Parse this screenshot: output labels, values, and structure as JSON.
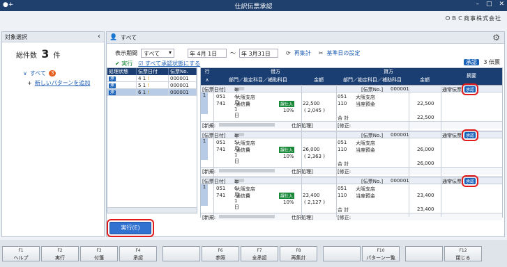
{
  "titlebar": {
    "title": "仕訳伝票承認",
    "logo": "●+"
  },
  "company": "ＯＢＣ商事株式会社",
  "left_panel": {
    "header": "対象選択",
    "total_label": "総件数",
    "total_value": "3",
    "total_unit": "件",
    "tree_all": "すべて",
    "tree_badge": "3",
    "tree_add": "新しいパターンを追加"
  },
  "main": {
    "header_label": "すべて",
    "period_label": "表示期間",
    "period_select": "すべて",
    "date_from": "年  4月  1日",
    "date_to": "年  3月31日",
    "tilde": "～",
    "recalc": "再集計",
    "base_date": "基準日の設定",
    "exec_link": "実行",
    "unapprove_link": "すべて承認状態にする",
    "approved_label": "承認",
    "approved_count": "3 伝票"
  },
  "slist": {
    "headers": [
      "処理状態",
      "伝票日付",
      "伝票No."
    ],
    "rows": [
      {
        "status": "承",
        "day": "4",
        "month_day": "1",
        "no": "000001"
      },
      {
        "status": "承",
        "day": "5",
        "month_day": "1",
        "no": "000001"
      },
      {
        "status": "承",
        "day": "6",
        "month_day": "1",
        "no": "000001"
      }
    ]
  },
  "grid": {
    "headers": {
      "row": "行",
      "debit": "借方",
      "credit": "貸方",
      "memo": "摘要",
      "dept": "部門／勘定科目／補助科目",
      "amount": "金額"
    },
    "entries": [
      {
        "date_label": "[伝票日付]",
        "date": "年  4月  1日",
        "no_label": "[伝票No.]",
        "no": "000001",
        "type": "通常伝票",
        "approve": "承認",
        "line": "1",
        "d_dept": "051",
        "d_dept_name": "大阪支店",
        "d_acc": "741",
        "d_acc_name": "通信費",
        "tax": "課仕入",
        "rate": "10%",
        "d_amount": "22,500",
        "d_tax": "( 2,045 )",
        "c_dept": "051",
        "c_dept_name": "大阪支店",
        "c_acc": "110",
        "c_acc_name": "当座預金",
        "c_amount": "22,500",
        "total_label": "合 計",
        "total": "22,500",
        "new_label": "[新規:",
        "proc": "仕訳処理]",
        "edit_label": "[修正:"
      },
      {
        "date_label": "[伝票日付]",
        "date": "年  5月  1日",
        "no_label": "[伝票No.]",
        "no": "000001",
        "type": "通常伝票",
        "approve": "承認",
        "line": "1",
        "d_dept": "051",
        "d_dept_name": "大阪支店",
        "d_acc": "741",
        "d_acc_name": "通信費",
        "tax": "課仕入",
        "rate": "10%",
        "d_amount": "26,000",
        "d_tax": "( 2,363 )",
        "c_dept": "051",
        "c_dept_name": "大阪支店",
        "c_acc": "110",
        "c_acc_name": "当座預金",
        "c_amount": "26,000",
        "total_label": "合 計",
        "total": "26,000",
        "new_label": "[新規:",
        "proc": "仕訳処理]",
        "edit_label": "[修正:"
      },
      {
        "date_label": "[伝票日付]",
        "date": "年  6月  1日",
        "no_label": "[伝票No.]",
        "no": "000001",
        "type": "通常伝票",
        "approve": "承認",
        "line": "1",
        "d_dept": "051",
        "d_dept_name": "大阪支店",
        "d_acc": "741",
        "d_acc_name": "通信費",
        "tax": "課仕入",
        "rate": "10%",
        "d_amount": "23,400",
        "d_tax": "( 2,127 )",
        "c_dept": "051",
        "c_dept_name": "大阪支店",
        "c_acc": "110",
        "c_acc_name": "当座預金",
        "c_amount": "23,400",
        "total_label": "合 計",
        "total": "23,400",
        "new_label": "[新規:",
        "proc": "仕訳処理]",
        "edit_label": "[修正:"
      }
    ]
  },
  "exec_button": "実行(E)",
  "fkeys": [
    {
      "key": "F1",
      "label": "ヘルプ"
    },
    {
      "key": "F2",
      "label": "実行"
    },
    {
      "key": "F3",
      "label": "付箋"
    },
    {
      "key": "F4",
      "label": "承認"
    },
    {
      "key": "",
      "label": ""
    },
    {
      "key": "F6",
      "label": "参照"
    },
    {
      "key": "F7",
      "label": "全承認"
    },
    {
      "key": "F8",
      "label": "再集計"
    },
    {
      "key": "",
      "label": ""
    },
    {
      "key": "F10",
      "label": "パターン一覧"
    },
    {
      "key": "",
      "label": ""
    },
    {
      "key": "F12",
      "label": "閉じる"
    }
  ]
}
